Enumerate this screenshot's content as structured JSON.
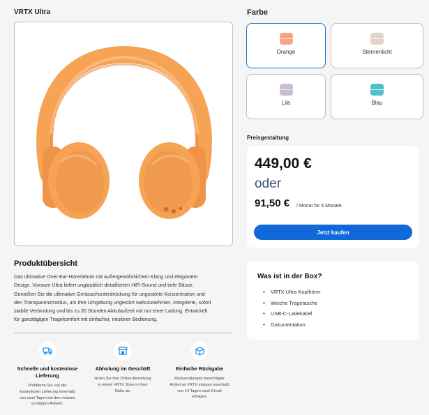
{
  "product": {
    "title": "VRTX Ultra",
    "headphone_color": "#f6a356"
  },
  "colors": {
    "heading": "Farbe",
    "options": [
      {
        "label": "Orange",
        "chip": "#f7a487",
        "selected": true
      },
      {
        "label": "Sternenlicht",
        "chip": "#e3d2c8",
        "selected": false
      },
      {
        "label": "Lila",
        "chip": "#c8bdd3",
        "selected": false
      },
      {
        "label": "Blau",
        "chip": "#4fc2c9",
        "selected": false
      }
    ]
  },
  "pricing": {
    "heading": "Preisgestaltung",
    "price": "449,00 €",
    "or_label": "oder",
    "monthly_price": "91,50 €",
    "monthly_note": "/ Monat für 6 Monate.",
    "buy_label": "Jetzt kaufen"
  },
  "overview": {
    "title": "Produktübersicht",
    "lines": [
      "Das ultimative Over-Ear-Hörerlebnis mit außergewöhnlichem Klang und elegantem",
      "Design. Voxsure Ultra liefert unglaublich detaillierten HiFi-Sound und tiefe Bässe.",
      "Genießen Sie die ultimative Geräuschunterdrückung für ungestörte Konzentration und",
      "den Transparenzmodus, um Ihre Umgebung ungestört wahrzunehmen. Integrierte, sofort",
      "stabile Verbindung und bis zu 30 Stunden Akkulaufzeit mit nur einer Ladung. Entwickelt",
      "für ganztägigen Tragekomfort mit einfacher, intuitiver Bedienung."
    ]
  },
  "features": [
    {
      "icon": "truck-icon",
      "title_lines": [
        "Schnelle und kostenlose",
        "Lieferung"
      ],
      "text_lines": [
        "Profitieren Sie von der",
        "kostenlosen Lieferung innerhalb",
        "von zwei Tagen bei den meisten",
        "vorrätigen Artikeln."
      ]
    },
    {
      "icon": "store-icon",
      "title_lines": [
        "Abholung im Geschäft"
      ],
      "text_lines": [
        "Holen Sie Ihre Online-Bestellung",
        "in einem VRTX Store in Ihrer",
        "Nähe ab."
      ]
    },
    {
      "icon": "box-icon",
      "title_lines": [
        "Einfache Rückgabe"
      ],
      "text_lines": [
        "Rücksendungen berechtigter",
        "Artikel an VRTX müssen innerhalb",
        "von 14 Tagen nach Erhalt",
        "erfolgen."
      ]
    }
  ],
  "box": {
    "title": "Was ist in der Box?",
    "items": [
      "VRTX Ultra Kopfhörer",
      "Weiche Tragetasche",
      "USB-C-Ladekabel",
      "Dokumentation"
    ]
  },
  "accent_color": "#1168d9",
  "icon_color": "#1f8ce6"
}
